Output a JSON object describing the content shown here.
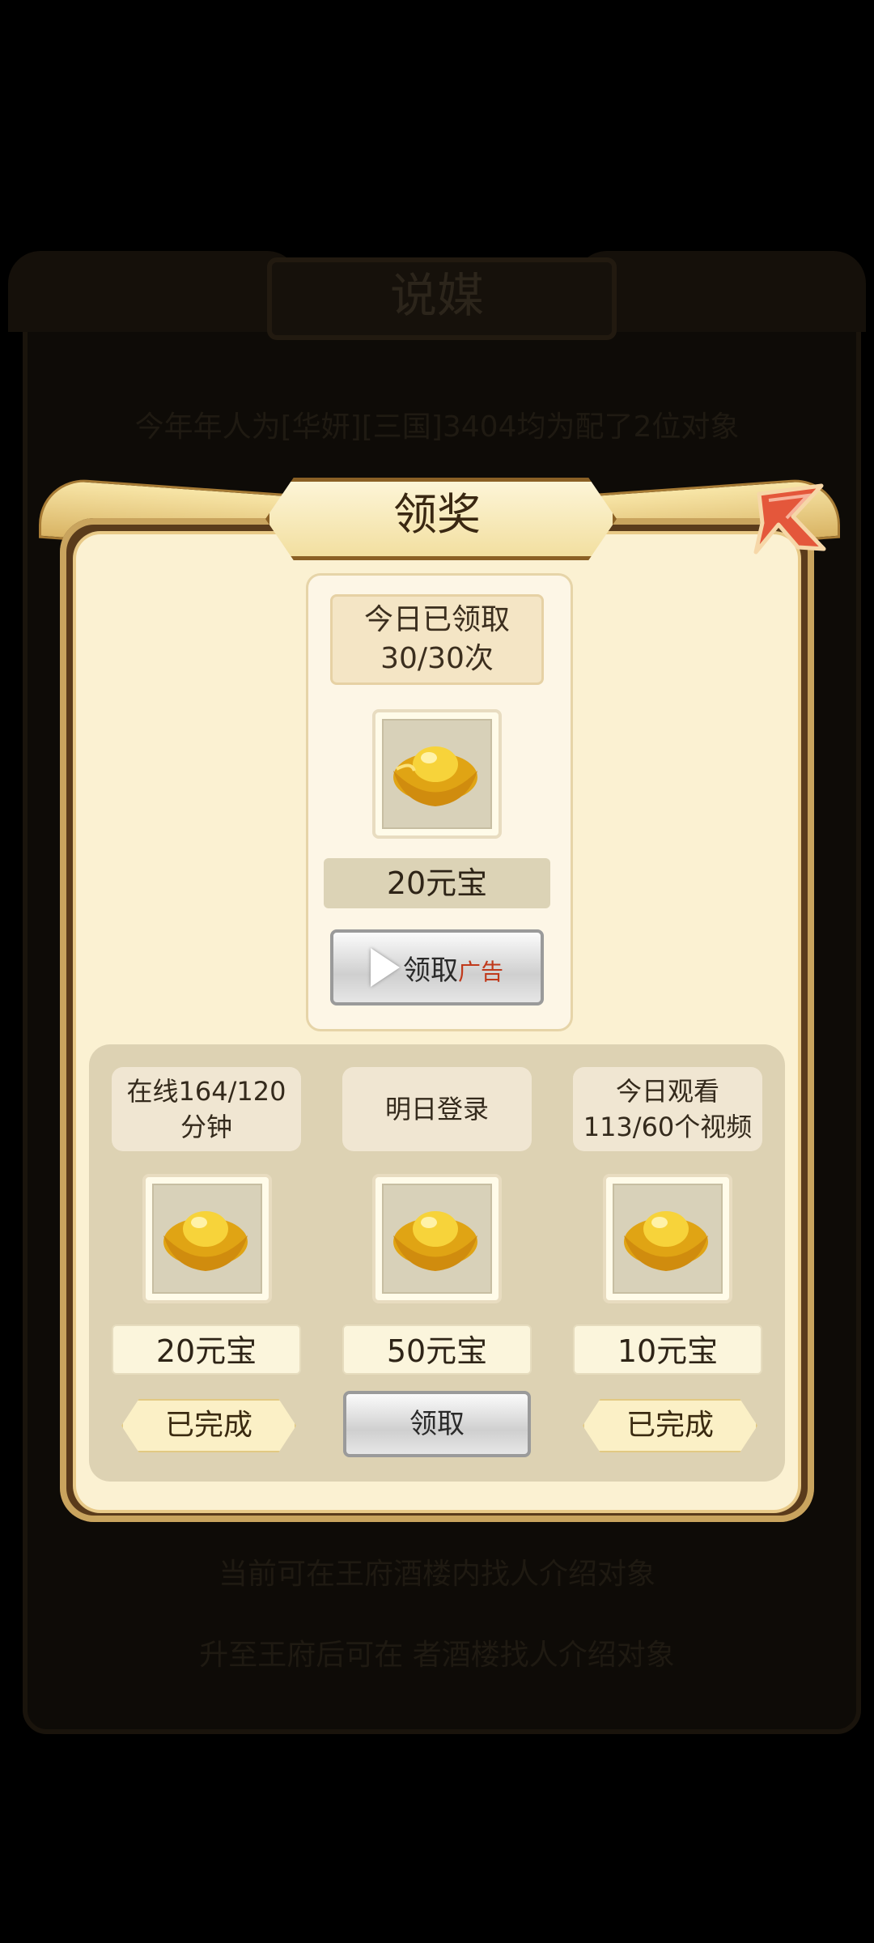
{
  "background": {
    "title": "说媒",
    "line1": "今年年人为[华妍][三国]3404均为配了2位对象",
    "line2": "当前可在王府酒楼内找人介绍对象",
    "line3": "升至王府后可在  者酒楼找人介绍对象"
  },
  "popup": {
    "title": "领奖",
    "close_icon": "close-x-icon"
  },
  "top_reward": {
    "label": "今日已领取30/30次",
    "item_icon": "gold-ingot-icon",
    "amount": "20元宝",
    "button_label": "领取",
    "button_ad_tag": "广告"
  },
  "tasks": [
    {
      "label": "在线164/120分钟",
      "item_icon": "gold-ingot-icon",
      "amount": "20元宝",
      "status": "已完成"
    },
    {
      "label": "明日登录",
      "item_icon": "gold-ingot-icon",
      "amount": "50元宝",
      "status": "领取"
    },
    {
      "label": "今日观看113/60个视频",
      "item_icon": "gold-ingot-icon",
      "amount": "10元宝",
      "status": "已完成"
    }
  ],
  "colors": {
    "accent_red": "#c0391b",
    "panel_cream": "#fbf1d2",
    "frame_brown": "#5a3b1b"
  }
}
